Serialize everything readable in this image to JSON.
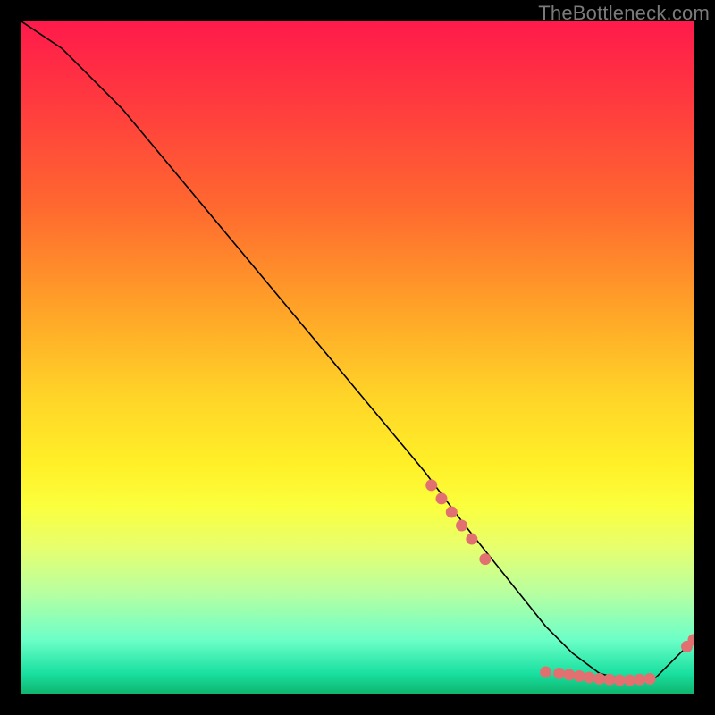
{
  "watermark": "TheBottleneck.com",
  "chart_data": {
    "type": "line",
    "title": "",
    "xlabel": "",
    "ylabel": "",
    "xlim": [
      0,
      100
    ],
    "ylim": [
      0,
      100
    ],
    "grid": false,
    "legend": false,
    "series": [
      {
        "name": "bottleneck-curve",
        "x": [
          0,
          3,
          6,
          10,
          15,
          20,
          30,
          40,
          50,
          60,
          66,
          70,
          74,
          78,
          82,
          86,
          90,
          94,
          100
        ],
        "y": [
          100,
          98,
          96,
          92,
          87,
          81,
          69,
          57,
          45,
          33,
          25,
          20,
          15,
          10,
          6,
          3,
          2,
          2,
          8
        ],
        "color": "#000000",
        "linewidth": 1.6
      }
    ],
    "scatter_points": {
      "name": "data-points",
      "color": "#e27070",
      "radius": 6.5,
      "points": [
        {
          "x": 61,
          "y": 31
        },
        {
          "x": 62.5,
          "y": 29
        },
        {
          "x": 64,
          "y": 27
        },
        {
          "x": 65.5,
          "y": 25
        },
        {
          "x": 67,
          "y": 23
        },
        {
          "x": 69,
          "y": 20
        },
        {
          "x": 78,
          "y": 3.2
        },
        {
          "x": 80,
          "y": 3.0
        },
        {
          "x": 81.5,
          "y": 2.8
        },
        {
          "x": 83,
          "y": 2.6
        },
        {
          "x": 84.5,
          "y": 2.4
        },
        {
          "x": 86,
          "y": 2.2
        },
        {
          "x": 87.5,
          "y": 2.1
        },
        {
          "x": 89,
          "y": 2.0
        },
        {
          "x": 90.5,
          "y": 2.0
        },
        {
          "x": 92,
          "y": 2.1
        },
        {
          "x": 93.5,
          "y": 2.2
        },
        {
          "x": 99,
          "y": 7
        },
        {
          "x": 100,
          "y": 8
        }
      ]
    }
  }
}
